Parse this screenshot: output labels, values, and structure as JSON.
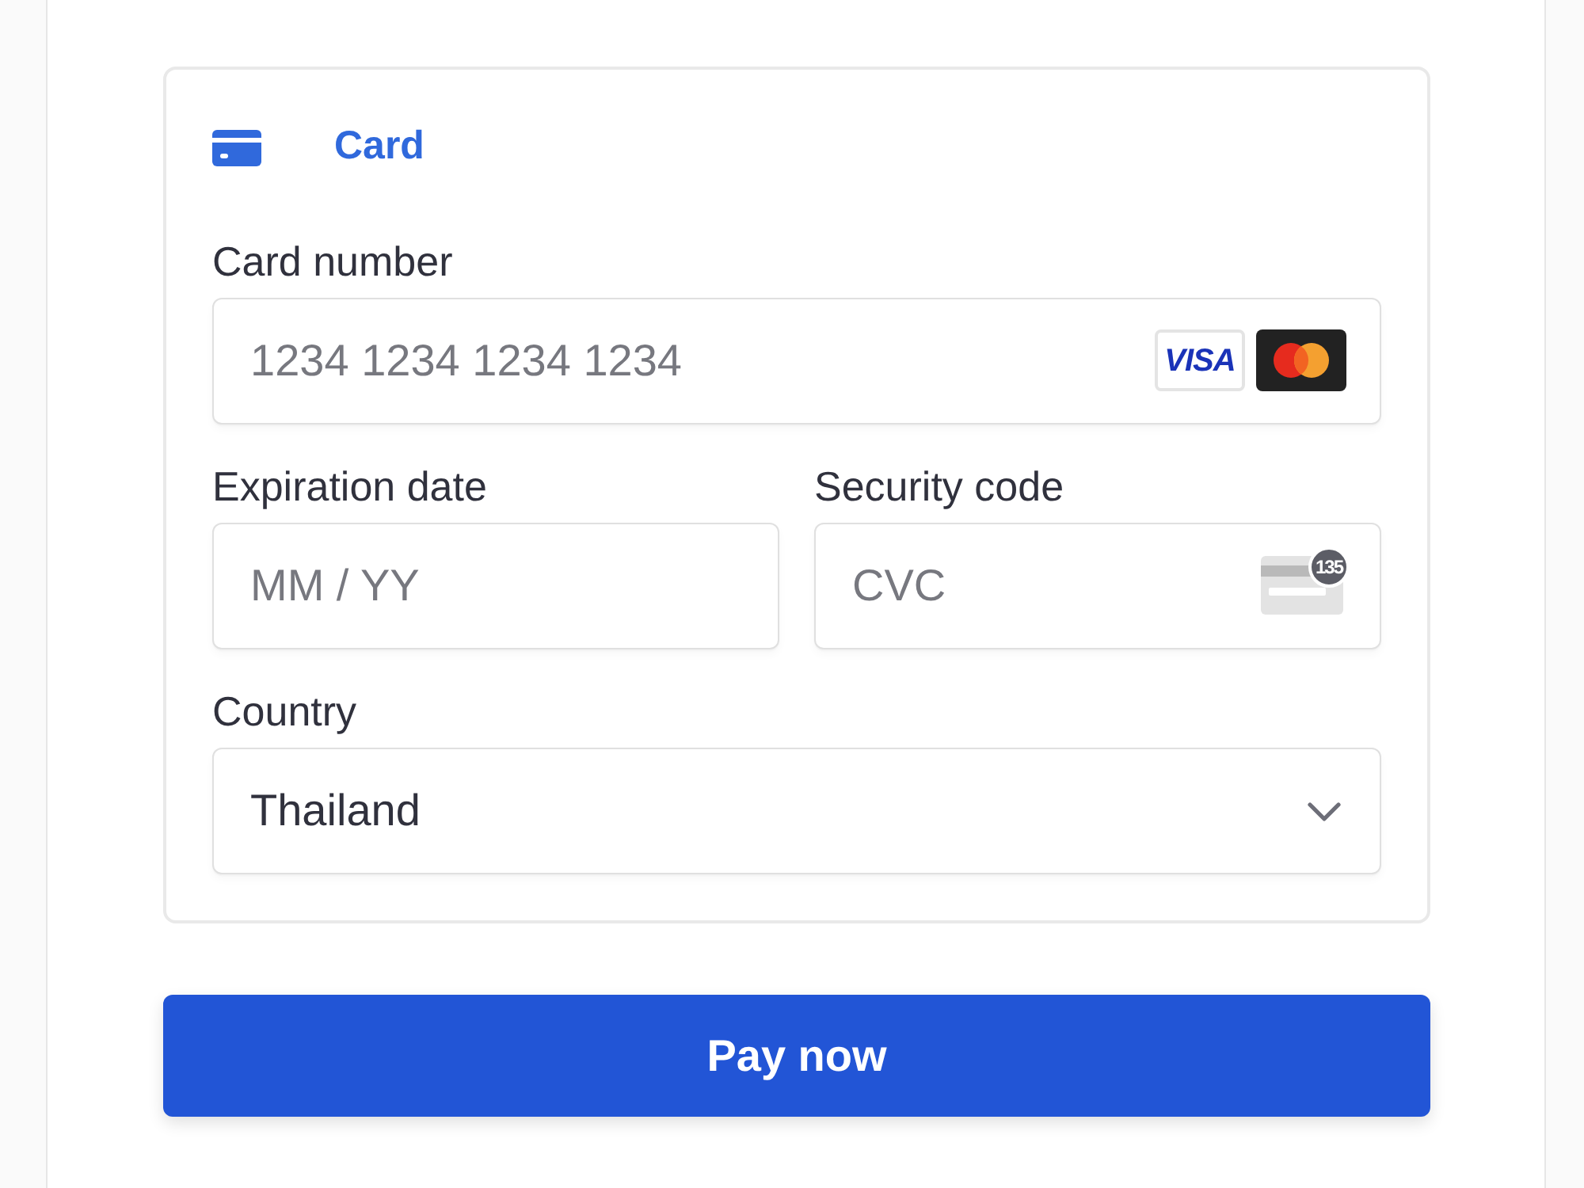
{
  "payment_method": {
    "label": "Card",
    "selected": true
  },
  "card_number": {
    "label": "Card number",
    "placeholder": "1234 1234 1234 1234",
    "brands": [
      {
        "kind": "visa",
        "text": "VISA"
      },
      {
        "kind": "mastercard"
      }
    ]
  },
  "expiration": {
    "label": "Expiration date",
    "placeholder": "MM / YY"
  },
  "security_code": {
    "label": "Security code",
    "placeholder": "CVC",
    "sample_digits": "135"
  },
  "country": {
    "label": "Country",
    "value": "Thailand"
  },
  "submit": {
    "label": "Pay now"
  }
}
